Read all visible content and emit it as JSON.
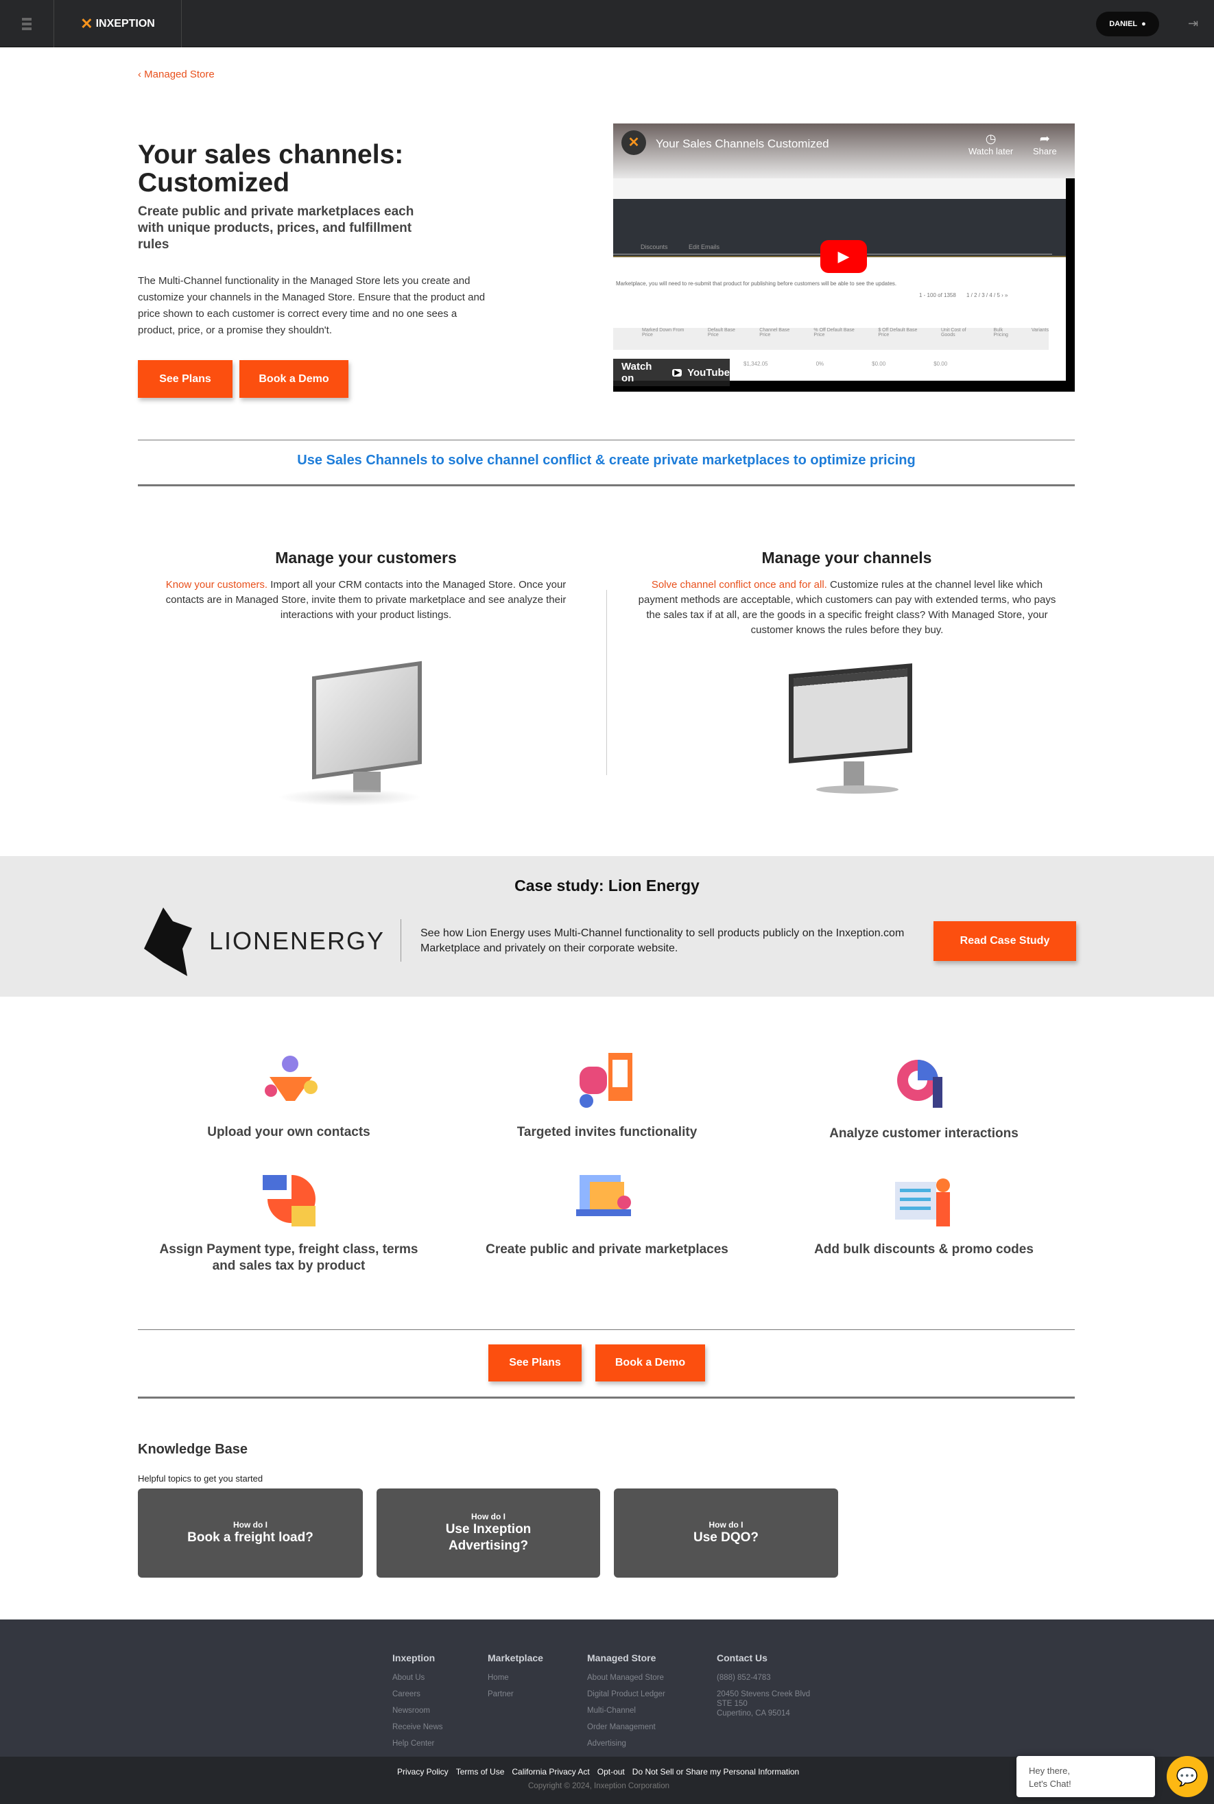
{
  "header": {
    "brand": "INXEPTION",
    "user": "DANIEL"
  },
  "breadcrumb": "Managed Store",
  "hero": {
    "title": "Your sales channels: Customized",
    "subtitle": "Create public and private marketplaces each with unique products, prices, and fulfillment rules",
    "description": "The Multi-Channel functionality in the Managed Store lets you create and customize your channels in the Managed Store. Ensure that the product and price shown to each customer is correct every time and no one sees a product, price, or a promise they shouldn't.",
    "see_plans": "See Plans",
    "book_demo": "Book a Demo"
  },
  "video": {
    "title": "Your Sales Channels Customized",
    "watch_later": "Watch later",
    "share": "Share",
    "watch_on": "Watch on",
    "youtube": "YouTube",
    "tabs": [
      "Discounts",
      "Edit Emails"
    ],
    "notice": "Marketplace, you will need to re-submit that product for publishing before customers will be able to see the updates.",
    "pagination": "1 - 100 of 1358",
    "pages": "1 / 2 / 3 / 4 / 5  ›  »",
    "columns": [
      "Marked Down From Price",
      "Default Base Price",
      "Channel Base Price",
      "% Off Default Base Price",
      "$ Off Default Base Price",
      "Unit Cost of Goods",
      "Bulk Pricing",
      "Variants"
    ],
    "row": [
      "$1,342.05",
      "0%",
      "$0.00",
      "$0.00"
    ]
  },
  "tagline": "Use Sales Channels to solve channel conflict & create private marketplaces to optimize pricing",
  "columns": [
    {
      "title": "Manage your customers",
      "highlight": "Know your customers.",
      "text": " Import all your CRM contacts into the Managed Store. Once your contacts are in Managed Store, invite them to private marketplace and see analyze their interactions with your product listings."
    },
    {
      "title": "Manage your channels",
      "highlight": "Solve channel conflict once and for all.",
      "text": " Customize rules at the channel level like which payment methods are acceptable, which customers can pay with extended terms, who pays the sales tax if at all, are the goods in a specific freight class? With Managed Store, your customer knows the rules before they buy."
    }
  ],
  "case_study": {
    "title": "Case study: Lion Energy",
    "logo_text": "LIONENERGY",
    "text": "See how Lion Energy uses Multi-Channel functionality to sell products publicly on the Inxeption.com Marketplace and privately on their corporate website.",
    "button": "Read Case Study"
  },
  "features": [
    "Upload your own contacts",
    "Targeted invites functionality",
    "Analyze customer interactions",
    "Assign Payment type, freight class, terms and sales tax by product",
    "Create public and private marketplaces",
    "Add bulk discounts & promo codes"
  ],
  "cta": {
    "see_plans": "See Plans",
    "book_demo": "Book a Demo"
  },
  "knowledge_base": {
    "title": "Knowledge Base",
    "subtitle": "Helpful topics to get you started",
    "cards": [
      {
        "pre": "How do I",
        "title": "Book a freight load?"
      },
      {
        "pre": "How do I",
        "title": "Use Inxeption Advertising?"
      },
      {
        "pre": "How do I",
        "title": "Use DQO?"
      }
    ]
  },
  "footer": {
    "columns": [
      {
        "title": "Inxeption",
        "links": [
          "About Us",
          "Careers",
          "Newsroom",
          "Receive News",
          "Help Center"
        ]
      },
      {
        "title": "Marketplace",
        "links": [
          "Home",
          "Partner"
        ]
      },
      {
        "title": "Managed Store",
        "links": [
          "About Managed Store",
          "Digital Product Ledger",
          "Multi-Channel",
          "Order Management",
          "Advertising"
        ]
      },
      {
        "title": "Contact Us",
        "links": [
          "(888) 852-4783",
          "20450 Stevens Creek Blvd",
          "STE 150",
          "Cupertino, CA 95014"
        ]
      }
    ],
    "legal": [
      "Privacy Policy",
      "Terms of Use",
      "California Privacy Act",
      "Opt-out",
      "Do Not Sell or Share my Personal Information"
    ],
    "copyright": "Copyright © 2024, Inxeption Corporation"
  },
  "chat": {
    "line1": "Hey there,",
    "line2": "Let's Chat!"
  },
  "colors": {
    "accent": "#fc4f0f",
    "link": "#1e7dd9",
    "header": "#27282a",
    "footer": "#343740"
  }
}
